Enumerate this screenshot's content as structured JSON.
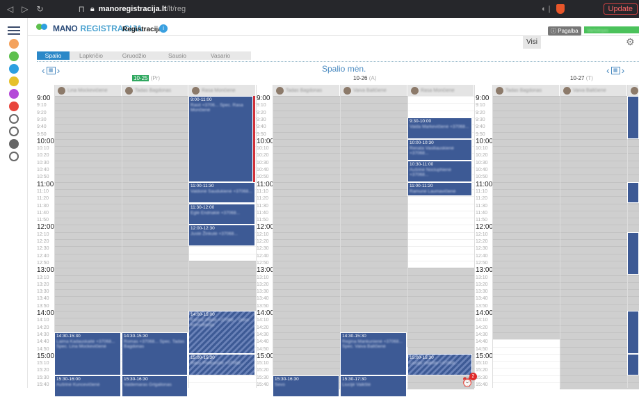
{
  "browser": {
    "url_domain": "manoregistracija.lt",
    "url_path": "/lt/reg",
    "update_label": "Update"
  },
  "header": {
    "logo_part1": "MANO",
    "logo_part2": "REGISTRACIJA",
    "nav_label": "Registracija",
    "help_label": "Pagalba",
    "visi_label": "Visi"
  },
  "months": [
    "Spalio",
    "Lapkričio",
    "Gruodžio",
    "Sausio",
    "Vasario"
  ],
  "calendar": {
    "title": "Spalio mėn.",
    "days": [
      {
        "date": "10-25",
        "weekday": "(Pr)"
      },
      {
        "date": "10-26",
        "weekday": "(A)"
      },
      {
        "date": "10-27",
        "weekday": "(T)"
      }
    ],
    "times": [
      "9:00",
      "9:10",
      "9:20",
      "9:30",
      "9:40",
      "9:50",
      "10:00",
      "10:10",
      "10:20",
      "10:30",
      "10:40",
      "10:50",
      "11:00",
      "11:10",
      "11:20",
      "11:30",
      "11:40",
      "11:50",
      "12:00",
      "12:10",
      "12:20",
      "12:30",
      "12:40",
      "12:50",
      "13:00",
      "13:10",
      "13:20",
      "13:30",
      "13:40",
      "13:50",
      "14:00",
      "14:10",
      "14:20",
      "14:30",
      "14:40",
      "14:50",
      "15:00",
      "15:10",
      "15:20",
      "15:30",
      "15:40"
    ],
    "staff": [
      "Lina Mockevičienė",
      "Tadas Bagdonas",
      "Rasa Mončienė",
      "Tadas Bagdonas",
      "Vaiva Baltčienė",
      "Rasa Mončienė",
      "Tadas Bagdonas",
      "Vaiva Baltčienė"
    ],
    "events": [
      {
        "time": "9:00-11:00",
        "detail": "Rasit +3706... Spec. Rasa Mončienė"
      },
      {
        "time": "11:00-11:30",
        "detail": "Valdonė Saudukienė +37068..."
      },
      {
        "time": "11:30-12:00",
        "detail": "Eglė Endriakiė +37068..."
      },
      {
        "time": "12:00-12:30",
        "detail": "Justė Žinkutė +37068..."
      },
      {
        "time": "14:00-15:00",
        "detail": "Karina Villulė +37068... Odos konsultacija"
      },
      {
        "time": "14:30-15:30",
        "detail": "Laima Kadauskaitė +37068... Spec. Lina Mockevičienė"
      },
      {
        "time": "14:30-15:30",
        "detail": "Romas +37068... Spec. Tadas Bagdonas"
      },
      {
        "time": "15:00-15:30",
        "detail": "Rasa Preiksnūtė +37068..."
      },
      {
        "time": "15:30-16:00",
        "detail": "Aušrinė Kuncevičienė"
      },
      {
        "time": "15:30-16:30",
        "detail": "Valdemaras Grigalionas"
      },
      {
        "time": "9:30-10:00",
        "detail": "Vaida Markevičienė +37068..."
      },
      {
        "time": "10:00-10:30",
        "detail": "Renata Vasiliauskienė +37068..."
      },
      {
        "time": "10:30-11:00",
        "detail": "Aušrinė Nociuphienė +37068..."
      },
      {
        "time": "11:00-11:20",
        "detail": "Ramunė Laumavičienė"
      },
      {
        "time": "14:30-15:30",
        "detail": "Regina Mankunienė +37068... Spec. Vaiva Baltčienė"
      },
      {
        "time": "15:00-15:30",
        "detail": "Liucija Vaikšte +37068..."
      },
      {
        "time": "15:30-16:30",
        "detail": "Sevo"
      },
      {
        "time": "15:30-17:30",
        "detail": "Liucijė Vaikštė"
      }
    ],
    "alarm_count": "2"
  },
  "colors": {
    "event": "#3d5a95",
    "accent": "#2b88c8",
    "today": "#30a860"
  }
}
